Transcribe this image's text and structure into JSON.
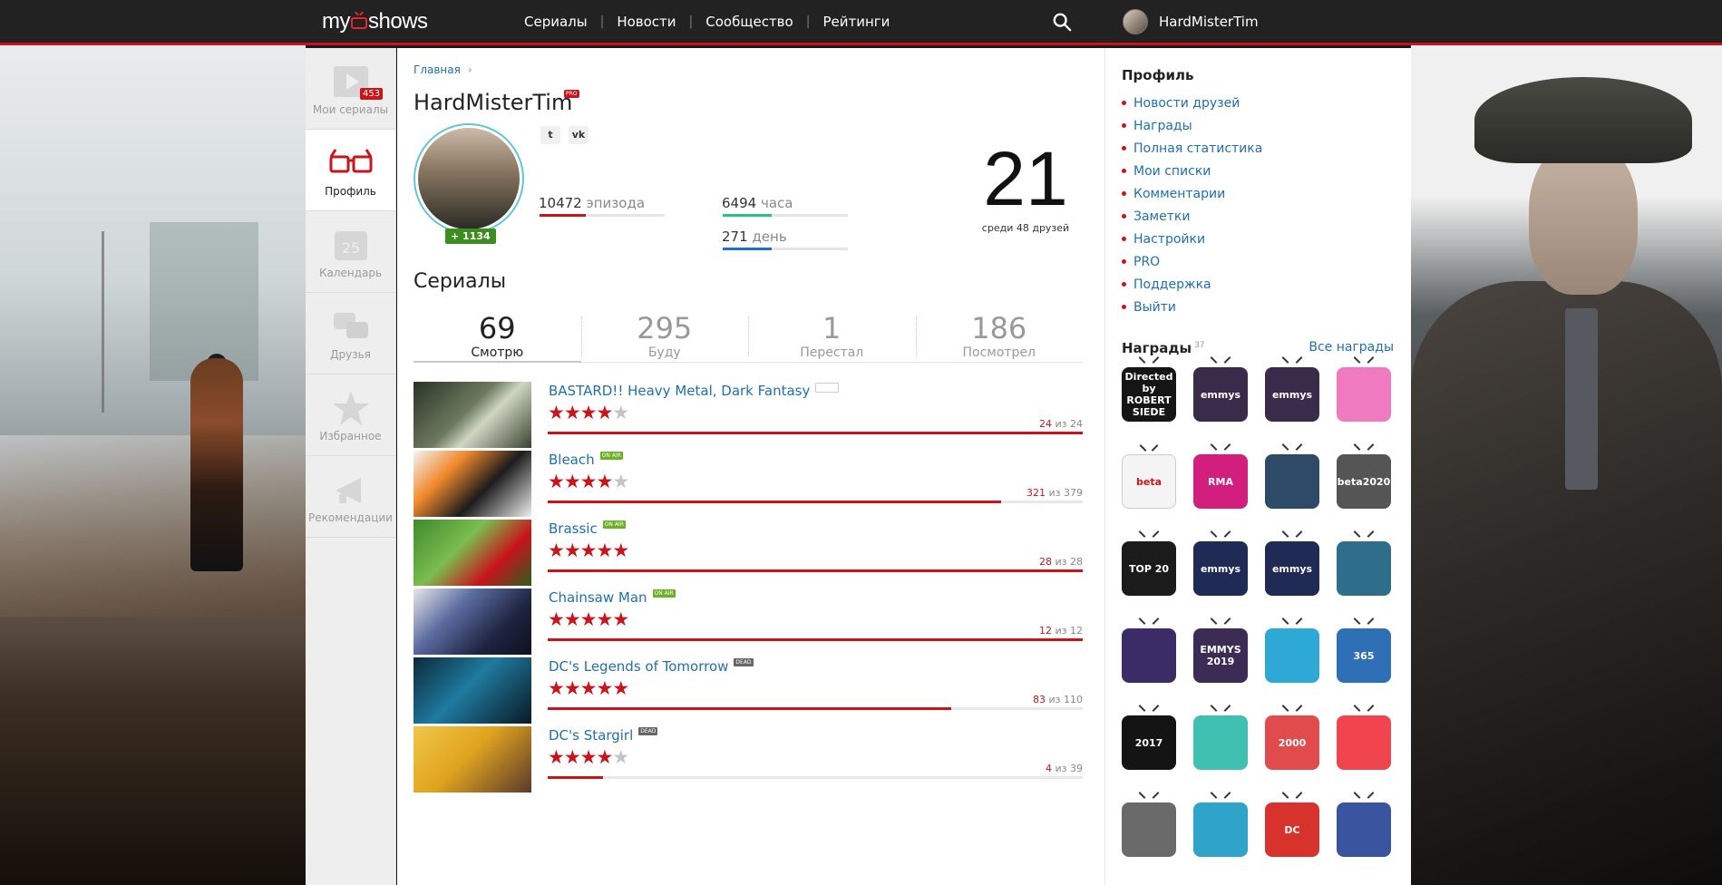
{
  "nav": {
    "logo": "myshows",
    "logo_left": "my",
    "logo_right": "shows",
    "links": [
      "Сериалы",
      "Новости",
      "Сообщество",
      "Рейтинги"
    ],
    "username": "HardMisterTim"
  },
  "sidebar": {
    "items": [
      {
        "label": "Мои сериалы",
        "badge": "453"
      },
      {
        "label": "Профиль"
      },
      {
        "label": "Календарь",
        "icon_text": "25"
      },
      {
        "label": "Друзья"
      },
      {
        "label": "Избранное"
      },
      {
        "label": "Рекомендации"
      }
    ]
  },
  "profile": {
    "breadcrumb": "Главная",
    "name": "HardMisterTim",
    "pro": "PRO",
    "karma": "+ 1134",
    "episodes_value": "10472",
    "episodes_unit": "эпизода",
    "episodes_fill": 0.37,
    "hours_value": "6494",
    "hours_unit": "часа",
    "hours_fill": 0.39,
    "days_value": "271",
    "days_unit": "день",
    "days_fill": 0.39,
    "rank": "21",
    "rank_sub": "среди 48 друзей"
  },
  "series": {
    "title": "Сериалы",
    "tabs": [
      {
        "num": "69",
        "label": "Смотрю"
      },
      {
        "num": "295",
        "label": "Буду"
      },
      {
        "num": "1",
        "label": "Перестал"
      },
      {
        "num": "186",
        "label": "Посмотрел"
      }
    ],
    "items": [
      {
        "title": "BASTARD!! Heavy Metal, Dark Fantasy",
        "tag": "PAUSE",
        "rating": 4,
        "watched": "24",
        "of": "из 24",
        "progress": 1.0
      },
      {
        "title": "Bleach",
        "tag": "ON AIR",
        "rating": 4,
        "watched": "321",
        "of": "из 379",
        "progress": 0.847
      },
      {
        "title": "Brassic",
        "tag": "ON AIR",
        "rating": 5,
        "watched": "28",
        "of": "из 28",
        "progress": 1.0
      },
      {
        "title": "Chainsaw Man",
        "tag": "ON AIR",
        "rating": 5,
        "watched": "12",
        "of": "из 12",
        "progress": 1.0
      },
      {
        "title": "DC's Legends of Tomorrow",
        "tag": "DEAD",
        "rating": 5,
        "watched": "83",
        "of": "из 110",
        "progress": 0.755
      },
      {
        "title": "DC's Stargirl",
        "tag": "DEAD",
        "rating": 4,
        "watched": "4",
        "of": "из 39",
        "progress": 0.103
      }
    ]
  },
  "right": {
    "profile_title": "Профиль",
    "links": [
      "Новости друзей",
      "Награды",
      "Полная статистика",
      "Мои списки",
      "Комментарии",
      "Заметки",
      "Настройки",
      "PRO",
      "Поддержка",
      "Выйти"
    ],
    "awards_title": "Награды",
    "awards_count": "37",
    "awards_all": "Все награды",
    "awards": [
      {
        "text": "Directed by ROBERT SIEDE",
        "color": "#151515"
      },
      {
        "text": "emmys",
        "color": "#3a2b4a"
      },
      {
        "text": "emmys",
        "color": "#3a2b4a"
      },
      {
        "text": "",
        "color": "#f07ac0"
      },
      {
        "text": "beta",
        "color": "#f4f4f4"
      },
      {
        "text": "RMA",
        "color": "#d21f7d"
      },
      {
        "text": "",
        "color": "#2d4b66"
      },
      {
        "text": "beta2020",
        "color": "#555555"
      },
      {
        "text": "TOP 20",
        "color": "#1b1b1b"
      },
      {
        "text": "emmys",
        "color": "#1f2a55"
      },
      {
        "text": "emmys",
        "color": "#1f2a55"
      },
      {
        "text": "",
        "color": "#2f6e8a"
      },
      {
        "text": "",
        "color": "#3b2b66"
      },
      {
        "text": "EMMYS 2019",
        "color": "#3b2b55"
      },
      {
        "text": "",
        "color": "#2ea9d6"
      },
      {
        "text": "365",
        "color": "#2f6fb6"
      },
      {
        "text": "2017",
        "color": "#141414"
      },
      {
        "text": "",
        "color": "#3fc0b0"
      },
      {
        "text": "2000",
        "color": "#e24b4b"
      },
      {
        "text": "",
        "color": "#f0444f"
      },
      {
        "text": "",
        "color": "#6a6a6a"
      },
      {
        "text": "",
        "color": "#2fa3c9"
      },
      {
        "text": "DC",
        "color": "#d8322c"
      },
      {
        "text": "",
        "color": "#3a55a0"
      }
    ]
  }
}
